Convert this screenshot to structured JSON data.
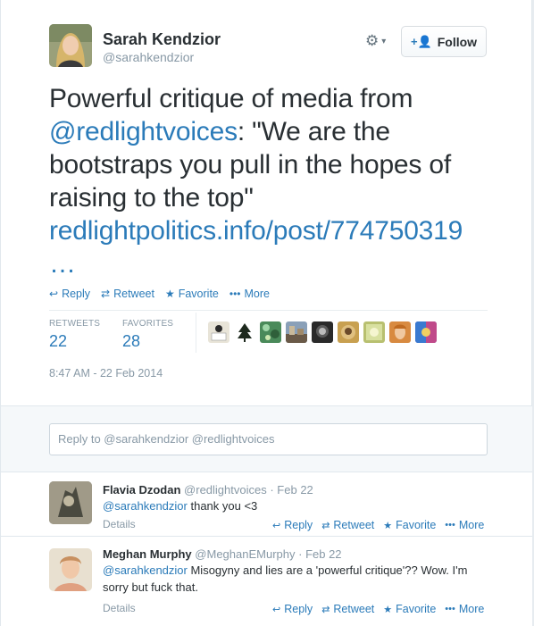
{
  "author": {
    "name": "Sarah Kendzior",
    "handle": "@sarahkendzior"
  },
  "header": {
    "follow_label": "Follow"
  },
  "tweet": {
    "line1": "Powerful critique of media from",
    "mention": "@redlightvoices",
    "line2_rest": ": \"We are the",
    "line3": "bootstraps you pull in the hopes of",
    "line4": "raising to the top\"",
    "link": "redlightpolitics.info/post/774750319",
    "ellipsis": "…"
  },
  "actions": {
    "reply": "Reply",
    "retweet": "Retweet",
    "favorite": "Favorite",
    "more": "More"
  },
  "stats": {
    "retweets_label": "RETWEETS",
    "retweets_value": "22",
    "favorites_label": "FAVORITES",
    "favorites_value": "28"
  },
  "timestamp": "8:47 AM - 22 Feb 2014",
  "reply_box": {
    "placeholder": "Reply to @sarahkendzior @redlightvoices"
  },
  "replies": [
    {
      "name": "Flavia Dzodan",
      "handle": "@redlightvoices",
      "date": "· Feb 22",
      "mention": "@sarahkendzior",
      "text": " thank you <3",
      "details": "Details"
    },
    {
      "name": "Meghan Murphy",
      "handle": "@MeghanEMurphy",
      "date": "· Feb 22",
      "mention": "@sarahkendzior",
      "text": " Misogyny and lies are a 'powerful critique'?? Wow. I'm sorry but fuck that.",
      "details": "Details"
    }
  ],
  "colors": {
    "link": "#2b7bb9",
    "muted": "#8899a6",
    "text": "#292f33",
    "reply_bg": "#f5f8fa"
  }
}
